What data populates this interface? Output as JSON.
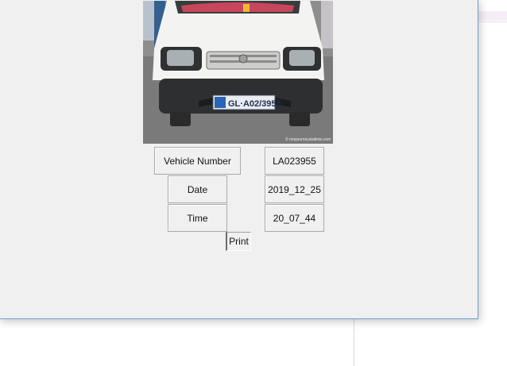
{
  "photo": {
    "plate_text": "GL·A02/3955",
    "watermark": "© onejourneyatatime.com"
  },
  "fields": {
    "vehicle_label": "Vehicle Number",
    "vehicle_value": "LA023955",
    "date_label": "Date",
    "date_value": "2019_12_25",
    "time_label": "Time",
    "time_value": "20_07_44"
  },
  "actions": {
    "print_label": "Print"
  }
}
